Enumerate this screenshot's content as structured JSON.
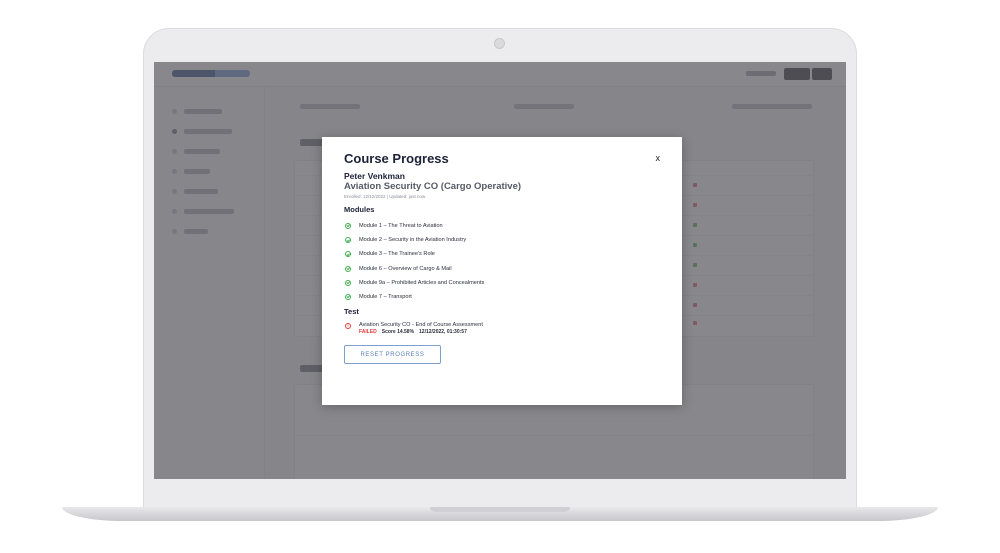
{
  "modal": {
    "title": "Course Progress",
    "close_label": "x",
    "student_name": "Peter Venkman",
    "course_name": "Aviation Security CO (Cargo Operative)",
    "meta": "Enrolled: 12/12/2022 | Updated: just now",
    "modules_heading": "Modules",
    "modules": [
      {
        "label": "Module 1 – The Threat to Aviation",
        "status": "complete"
      },
      {
        "label": "Module 2 – Security in the Aviation Industry",
        "status": "complete"
      },
      {
        "label": "Module 3 – The Trainee's Role",
        "status": "complete"
      },
      {
        "label": "Module 6 – Overview of Cargo & Mail",
        "status": "complete"
      },
      {
        "label": "Module 9a – Prohibited Articles and Concealments",
        "status": "complete"
      },
      {
        "label": "Module 7 – Transport",
        "status": "complete"
      }
    ],
    "test_heading": "Test",
    "test": {
      "label": "Aviation Security CO - End of Course Assessment",
      "status": "FAILED",
      "score": "Score 14.58%",
      "timestamp": "12/12/2022, 01:30:57"
    },
    "reset_label": "RESET PROGRESS"
  },
  "colors": {
    "success": "#3fae50",
    "failed": "#e23b3b",
    "accent": "#5b80b8",
    "title": "#1c2238"
  },
  "icons": {
    "module_status": "check-circle-icon",
    "test_status": "alert-circle-icon"
  }
}
